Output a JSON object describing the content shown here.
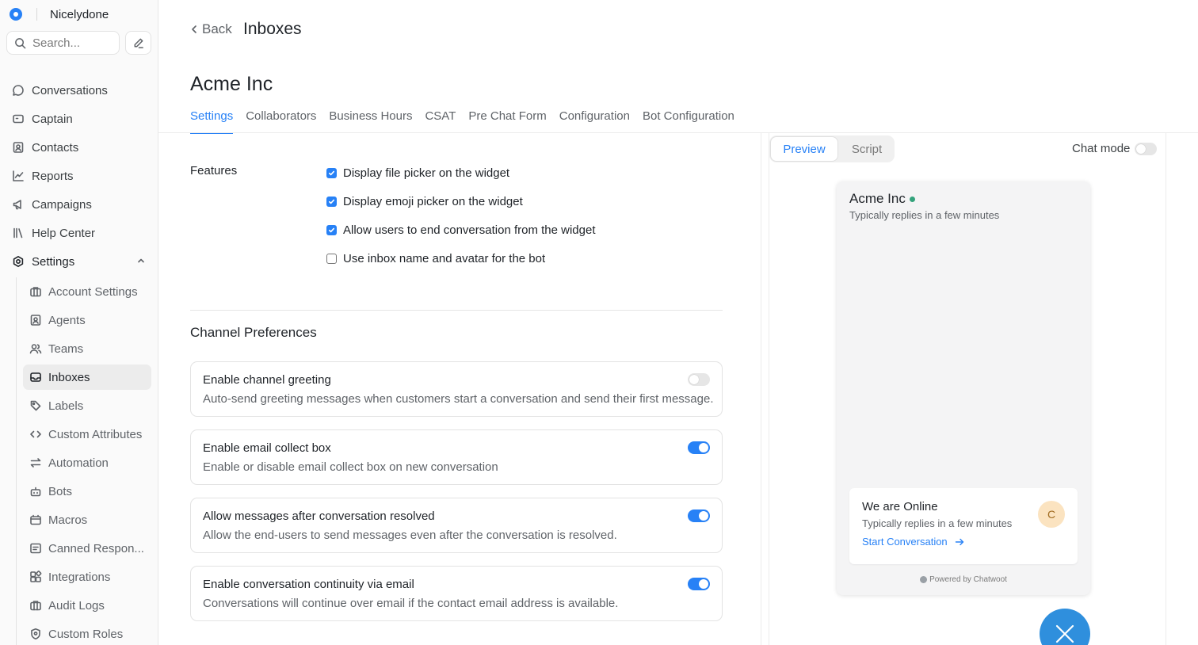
{
  "brand": {
    "name": "Nicelydone"
  },
  "search": {
    "placeholder": "Search..."
  },
  "sidebar": {
    "items": [
      {
        "label": "Conversations",
        "icon": "chat-bubble-icon"
      },
      {
        "label": "Captain",
        "icon": "captain-icon"
      },
      {
        "label": "Contacts",
        "icon": "contacts-icon"
      },
      {
        "label": "Reports",
        "icon": "chart-line-icon"
      },
      {
        "label": "Campaigns",
        "icon": "megaphone-icon"
      },
      {
        "label": "Help Center",
        "icon": "library-icon"
      },
      {
        "label": "Settings",
        "icon": "settings-gear-icon"
      }
    ],
    "settings_items": [
      {
        "label": "Account Settings",
        "icon": "briefcase-icon"
      },
      {
        "label": "Agents",
        "icon": "agent-icon"
      },
      {
        "label": "Teams",
        "icon": "team-icon"
      },
      {
        "label": "Inboxes",
        "icon": "inbox-icon",
        "active": true
      },
      {
        "label": "Labels",
        "icon": "tag-icon"
      },
      {
        "label": "Custom Attributes",
        "icon": "code-icon"
      },
      {
        "label": "Automation",
        "icon": "automation-icon"
      },
      {
        "label": "Bots",
        "icon": "bot-icon"
      },
      {
        "label": "Macros",
        "icon": "macro-icon"
      },
      {
        "label": "Canned Respon...",
        "icon": "canned-response-icon"
      },
      {
        "label": "Integrations",
        "icon": "integrations-icon"
      },
      {
        "label": "Audit Logs",
        "icon": "audit-icon"
      },
      {
        "label": "Custom Roles",
        "icon": "shield-icon"
      }
    ]
  },
  "header": {
    "back_label": "Back",
    "title": "Inboxes"
  },
  "inbox": {
    "name": "Acme Inc"
  },
  "tabs": [
    {
      "label": "Settings",
      "active": true
    },
    {
      "label": "Collaborators"
    },
    {
      "label": "Business Hours"
    },
    {
      "label": "CSAT"
    },
    {
      "label": "Pre Chat Form"
    },
    {
      "label": "Configuration"
    },
    {
      "label": "Bot Configuration"
    }
  ],
  "features": {
    "label": "Features",
    "options": [
      {
        "label": "Display file picker on the widget",
        "checked": true
      },
      {
        "label": "Display emoji picker on the widget",
        "checked": true
      },
      {
        "label": "Allow users to end conversation from the widget",
        "checked": true
      },
      {
        "label": "Use inbox name and avatar for the bot",
        "checked": false
      }
    ]
  },
  "channel_preferences": {
    "title": "Channel Preferences",
    "items": [
      {
        "title": "Enable channel greeting",
        "description": "Auto-send greeting messages when customers start a conversation and send their first message.",
        "enabled": false
      },
      {
        "title": "Enable email collect box",
        "description": "Enable or disable email collect box on new conversation",
        "enabled": true
      },
      {
        "title": "Allow messages after conversation resolved",
        "description": "Allow the end-users to send messages even after the conversation is resolved.",
        "enabled": true
      },
      {
        "title": "Enable conversation continuity via email",
        "description": "Conversations will continue over email if the contact email address is available.",
        "enabled": true
      }
    ]
  },
  "preview": {
    "tabs": {
      "preview": "Preview",
      "script": "Script"
    },
    "chat_mode_label": "Chat mode",
    "chat_mode_enabled": false,
    "widget": {
      "name": "Acme Inc",
      "subtitle": "Typically replies in a few minutes",
      "card_title": "We are Online",
      "card_subtitle": "Typically replies in a few minutes",
      "start_label": "Start Conversation",
      "avatar_initial": "C",
      "powered_by": "Powered by Chatwoot"
    }
  },
  "colors": {
    "accent": "#2781f6",
    "online": "#34a37c",
    "fab": "#2f8fdd"
  }
}
